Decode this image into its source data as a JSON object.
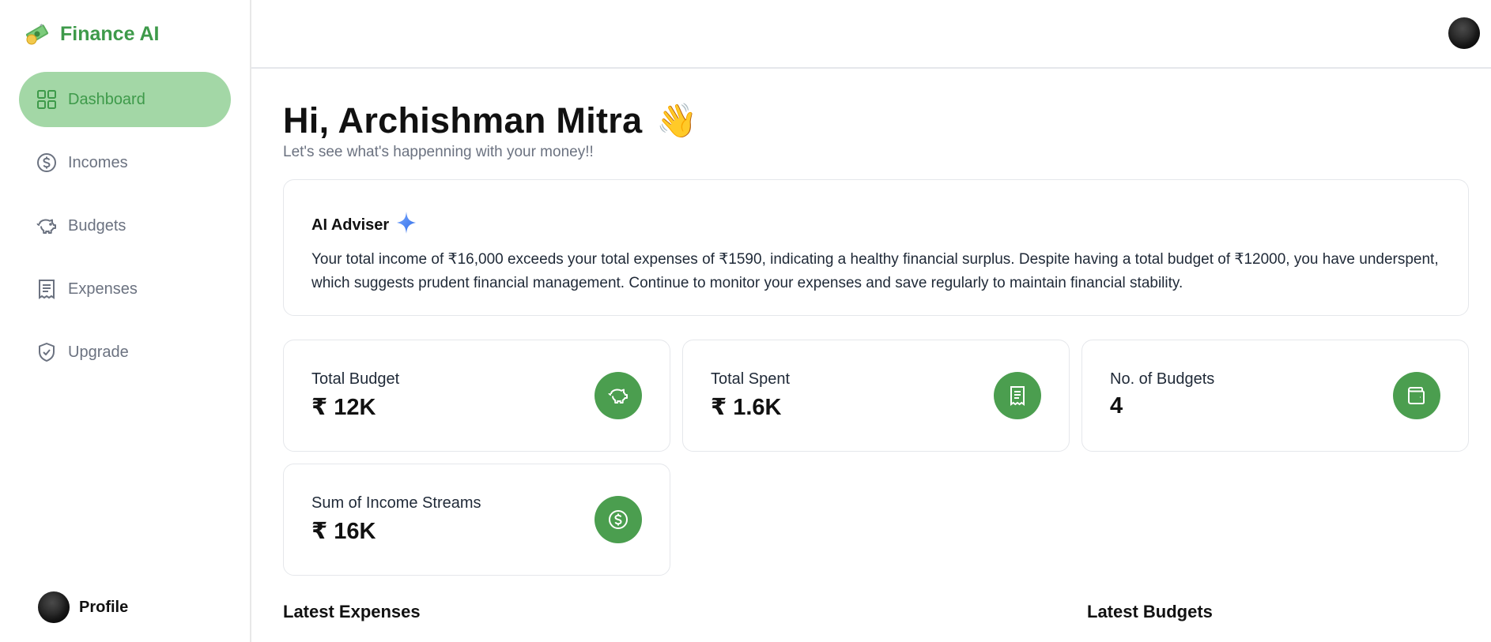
{
  "brand": {
    "name": "Finance AI",
    "icon": "money-icon"
  },
  "sidebar": {
    "items": [
      {
        "label": "Dashboard",
        "icon": "dashboard-icon",
        "active": true
      },
      {
        "label": "Incomes",
        "icon": "dollar-circle-icon",
        "active": false
      },
      {
        "label": "Budgets",
        "icon": "piggy-bank-icon",
        "active": false
      },
      {
        "label": "Expenses",
        "icon": "receipt-icon",
        "active": false
      },
      {
        "label": "Upgrade",
        "icon": "shield-check-icon",
        "active": false
      }
    ],
    "profile_label": "Profile"
  },
  "header": {
    "greeting": "Hi, Archishman Mitra",
    "wave": "👋",
    "subtitle": "Let's see what's happenning with your money!!"
  },
  "advisor": {
    "title": "AI Adviser",
    "text": "Your total income of ₹16,000 exceeds your total expenses of ₹1590, indicating a healthy financial surplus. Despite having a total budget of ₹12000, you have underspent, which suggests prudent financial management. Continue to monitor your expenses and save regularly to maintain financial stability."
  },
  "cards": [
    {
      "label": "Total Budget",
      "value": "₹ 12K",
      "icon": "piggy-bank-icon"
    },
    {
      "label": "Total Spent",
      "value": "₹ 1.6K",
      "icon": "receipt-icon"
    },
    {
      "label": "No. of Budgets",
      "value": "4",
      "icon": "wallet-icon"
    },
    {
      "label": "Sum of Income Streams",
      "value": "₹ 16K",
      "icon": "dollar-circle-icon"
    }
  ],
  "sections": {
    "latest_expenses": "Latest Expenses",
    "latest_budgets": "Latest Budgets"
  },
  "colors": {
    "brand_green": "#3e9a4a",
    "active_nav_bg": "#a3d7a6",
    "badge_green": "#4b9e4f",
    "muted_text": "#6b7280"
  }
}
